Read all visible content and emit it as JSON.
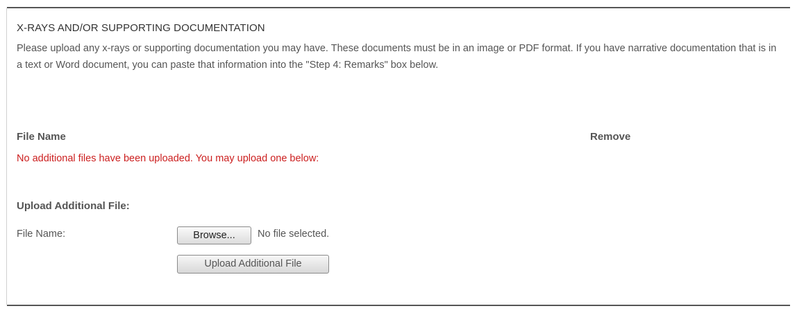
{
  "section": {
    "title": "X-RAYS AND/OR SUPPORTING DOCUMENTATION",
    "description": "Please upload any x-rays or supporting documentation you may have. These documents must be in an image or PDF format. If you have narrative documentation that is in a text or Word document, you can paste that information into the \"Step 4: Remarks\" box below."
  },
  "files_table": {
    "columns": [
      "File Name",
      "Remove"
    ],
    "empty_message": "No additional files have been uploaded. You may upload one below:"
  },
  "upload": {
    "heading": "Upload Additional File:",
    "file_label": "File Name:",
    "browse_label": "Browse...",
    "file_status": "No file selected.",
    "submit_label": "Upload Additional File"
  },
  "colors": {
    "error_text": "#cc1f1f",
    "body_text": "#555555",
    "rule": "#555555"
  }
}
